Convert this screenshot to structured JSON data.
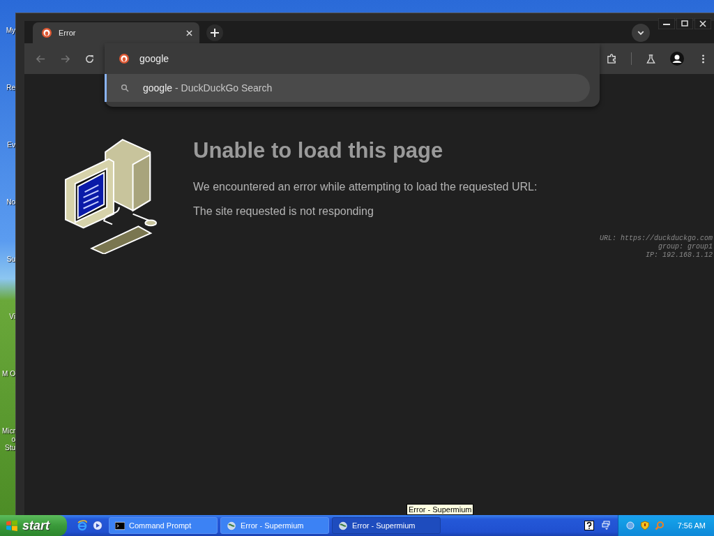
{
  "desktop": {
    "icons": [
      "My",
      "Re",
      "Ev",
      "No",
      "Su",
      "Vi",
      "M O",
      "Micro Stu"
    ]
  },
  "browser": {
    "tabs": [
      {
        "title": "Error",
        "selected": true
      }
    ],
    "omnibox": {
      "value": "google"
    },
    "suggestions": [
      {
        "query": "google",
        "source": "- DuckDuckGo Search",
        "selected": true
      }
    ],
    "error": {
      "heading": "Unable to load this page",
      "message": "We encountered an error while attempting to load the requested URL:",
      "detail": "The site requested is not responding",
      "info": [
        "URL: https://duckduckgo.com",
        "group: group1",
        "IP: 192.168.1.12"
      ]
    }
  },
  "tooltip": "Error - Supermium",
  "taskbar": {
    "start": "start",
    "tasks": [
      {
        "label": "Command Prompt",
        "kind": "console",
        "selected": false
      },
      {
        "label": "Error - Supermium",
        "kind": "browser",
        "selected": false
      },
      {
        "label": "Error - Supermium",
        "kind": "browser",
        "selected": true
      }
    ],
    "clock": "7:56 AM"
  }
}
